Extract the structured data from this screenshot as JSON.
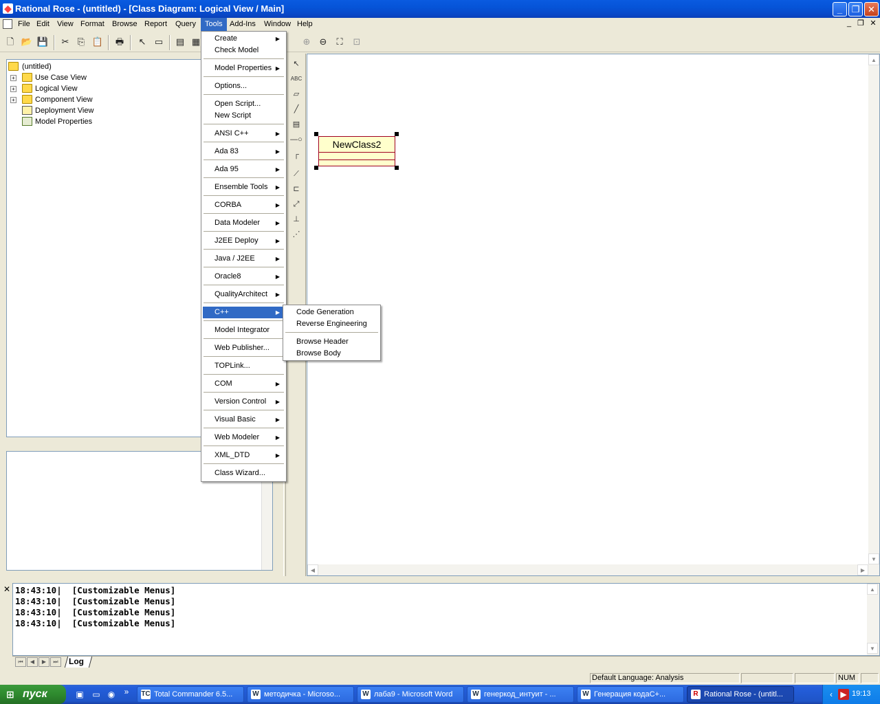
{
  "window": {
    "title": "Rational Rose - (untitled) - [Class Diagram: Logical View / Main]",
    "minimize": "_",
    "restore": "❐",
    "close": "✕"
  },
  "menubar": {
    "items": [
      "File",
      "Edit",
      "View",
      "Format",
      "Browse",
      "Report",
      "Query",
      "Tools",
      "Add-Ins",
      "Window",
      "Help"
    ],
    "active": "Tools"
  },
  "browser": {
    "root": "(untitled)",
    "items": [
      {
        "label": "Use Case View",
        "icon": "folder-icon",
        "expandable": true
      },
      {
        "label": "Logical View",
        "icon": "folder-icon",
        "expandable": true
      },
      {
        "label": "Component View",
        "icon": "folder-icon",
        "expandable": true
      },
      {
        "label": "Deployment View",
        "icon": "component-icon",
        "expandable": false
      },
      {
        "label": "Model Properties",
        "icon": "model-icon",
        "expandable": false
      }
    ]
  },
  "tools_menu": {
    "items": [
      {
        "label": "Create",
        "submenu": true
      },
      {
        "label": "Check Model",
        "submenu": false
      },
      {
        "label": "Model Properties",
        "submenu": true
      },
      {
        "label": "Options...",
        "submenu": false
      },
      {
        "label": "Open Script...",
        "submenu": false
      },
      {
        "label": "New Script",
        "submenu": false
      },
      {
        "label": "ANSI C++",
        "submenu": true
      },
      {
        "label": "Ada 83",
        "submenu": true
      },
      {
        "label": "Ada 95",
        "submenu": true
      },
      {
        "label": "Ensemble Tools",
        "submenu": true
      },
      {
        "label": "CORBA",
        "submenu": true
      },
      {
        "label": "Data Modeler",
        "submenu": true
      },
      {
        "label": "J2EE Deploy",
        "submenu": true
      },
      {
        "label": "Java / J2EE",
        "submenu": true
      },
      {
        "label": "Oracle8",
        "submenu": true
      },
      {
        "label": "QualityArchitect",
        "submenu": true
      },
      {
        "label": "C++",
        "submenu": true,
        "highlight": true
      },
      {
        "label": "Model Integrator",
        "submenu": false
      },
      {
        "label": "Web Publisher...",
        "submenu": false
      },
      {
        "label": "TOPLink...",
        "submenu": false
      },
      {
        "label": "COM",
        "submenu": true
      },
      {
        "label": "Version Control",
        "submenu": true
      },
      {
        "label": "Visual Basic",
        "submenu": true
      },
      {
        "label": "Web Modeler",
        "submenu": true
      },
      {
        "label": "XML_DTD",
        "submenu": true
      },
      {
        "label": "Class Wizard...",
        "submenu": false
      }
    ]
  },
  "cpp_submenu": {
    "items": [
      "Code Generation",
      "Reverse Engineering",
      "Browse Header",
      "Browse Body"
    ]
  },
  "diagram": {
    "class_name": "NewClass2"
  },
  "log": {
    "lines": [
      "18:43:10|  [Customizable Menus]",
      "18:43:10|  [Customizable Menus]",
      "18:43:10|  [Customizable Menus]",
      "18:43:10|  [Customizable Menus]"
    ],
    "close": "✕",
    "tab": "Log"
  },
  "statusbar": {
    "language": "Default Language: Analysis",
    "num": "NUM"
  },
  "taskbar": {
    "start": "пуск",
    "overflow": "»",
    "tasks": [
      {
        "label": "Total Commander 6.5...",
        "icon": "TC"
      },
      {
        "label": "методичка - Microso...",
        "icon": "W"
      },
      {
        "label": "лаба9 - Microsoft Word",
        "icon": "W"
      },
      {
        "label": "генеркод_интуит - ...",
        "icon": "W"
      },
      {
        "label": "Генерация кодаC+...",
        "icon": "W"
      },
      {
        "label": "Rational Rose - (untitl...",
        "icon": "R",
        "active": true
      }
    ],
    "clock": "19:13"
  },
  "colors": {
    "titlebar": "#0654d8",
    "menu_highlight": "#316ac5",
    "class_fill": "#ffffcc",
    "class_border": "#a00020"
  }
}
